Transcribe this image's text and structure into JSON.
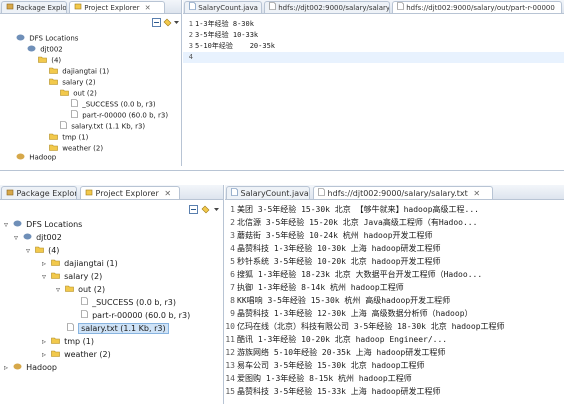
{
  "top": {
    "explorer_tabs": [
      "Package Explore",
      "Project Explorer"
    ],
    "editor_tabs": [
      "SalaryCount.java",
      "hdfs://djt002:9000/salary/salary.txt",
      "hdfs://djt002:9000/salary/out/part-r-00000"
    ],
    "tree": [
      {
        "label": "DFS Locations",
        "icon": "elephant-icon"
      },
      {
        "label": "djt002",
        "icon": "elephant-icon"
      },
      {
        "label": "(4)",
        "icon": "folder-icon"
      },
      {
        "label": "dajiangtai (1)",
        "icon": "folder-icon"
      },
      {
        "label": "salary (2)",
        "icon": "folder-icon"
      },
      {
        "label": "out (2)",
        "icon": "folder-icon"
      },
      {
        "label": "_SUCCESS (0.0 b, r3)",
        "icon": "file-icon"
      },
      {
        "label": "part-r-00000 (60.0 b, r3)",
        "icon": "file-icon"
      },
      {
        "label": "salary.txt (1.1 Kb, r3)",
        "icon": "file-icon"
      },
      {
        "label": "tmp (1)",
        "icon": "folder-icon"
      },
      {
        "label": "weather (2)",
        "icon": "folder-icon"
      },
      {
        "label": "Hadoop",
        "icon": "elephant-icon"
      }
    ],
    "editor_lines": [
      {
        "n": "1",
        "text": "1-3年经验 8-30k"
      },
      {
        "n": "2",
        "text": "3-5年经验 10-33k"
      },
      {
        "n": "3",
        "text": "5-10年经验    20-35k"
      },
      {
        "n": "4",
        "text": ""
      }
    ]
  },
  "bottom": {
    "explorer_tabs": [
      "Package Explore",
      "Project Explorer"
    ],
    "editor_tabs": [
      "SalaryCount.java",
      "hdfs://djt002:9000/salary/salary.txt"
    ],
    "tree": [
      {
        "label": "DFS Locations",
        "arrow": "▿"
      },
      {
        "label": "djt002",
        "arrow": "▿"
      },
      {
        "label": "(4)",
        "arrow": "▿"
      },
      {
        "label": "dajiangtai (1)",
        "arrow": "▹"
      },
      {
        "label": "salary (2)",
        "arrow": "▿"
      },
      {
        "label": "out (2)",
        "arrow": "▿"
      },
      {
        "label": "_SUCCESS (0.0 b, r3)",
        "arrow": ""
      },
      {
        "label": "part-r-00000 (60.0 b, r3)",
        "arrow": ""
      },
      {
        "label": "salary.txt (1.1 Kb, r3)",
        "arrow": "",
        "selected": true
      },
      {
        "label": "tmp (1)",
        "arrow": "▹"
      },
      {
        "label": "weather (2)",
        "arrow": "▹"
      },
      {
        "label": "Hadoop",
        "arrow": "▹"
      }
    ],
    "editor_lines": [
      {
        "n": "1",
        "text": "美团 3-5年经验 15-30k 北京 【够牛就来】hadoop高级工程..."
      },
      {
        "n": "2",
        "text": "北信源 3-5年经验 15-20k 北京 Java高级工程师（有Hadoo..."
      },
      {
        "n": "3",
        "text": "蘑菇街 3-5年经验 10-24k 杭州 hadoop开发工程师"
      },
      {
        "n": "4",
        "text": "晶赞科技 1-3年经验 10-30k 上海 hadoop研发工程师"
      },
      {
        "n": "5",
        "text": "秒针系统 3-5年经验 10-20k 北京 hadoop开发工程师"
      },
      {
        "n": "6",
        "text": "搜狐 1-3年经验 18-23k 北京 大数据平台开发工程师（Hadoo..."
      },
      {
        "n": "7",
        "text": "执御 1-3年经验 8-14k 杭州 hadoop工程师"
      },
      {
        "n": "8",
        "text": "KK唱响 3-5年经验 15-30k 杭州 高级hadoop开发工程师"
      },
      {
        "n": "9",
        "text": "晶赞科技 1-3年经验 12-30k 上海 高级数据分析师（hadoop）"
      },
      {
        "n": "10",
        "text": "亿玛在线（北京）科技有限公司 3-5年经验 18-30k 北京 hadoop工程师"
      },
      {
        "n": "11",
        "text": "酷讯 1-3年经验 10-20k 北京 hadoop Engineer/..."
      },
      {
        "n": "12",
        "text": "游族网络 5-10年经验 20-35k 上海 hadoop研发工程师"
      },
      {
        "n": "13",
        "text": "易车公司 3-5年经验 15-30k 北京 hadoop工程师"
      },
      {
        "n": "14",
        "text": "爱图购 1-3年经验 8-15k 杭州 hadoop工程师"
      },
      {
        "n": "15",
        "text": "晶赞科技 3-5年经验 15-33k 上海 hadoop研发工程师"
      }
    ]
  }
}
